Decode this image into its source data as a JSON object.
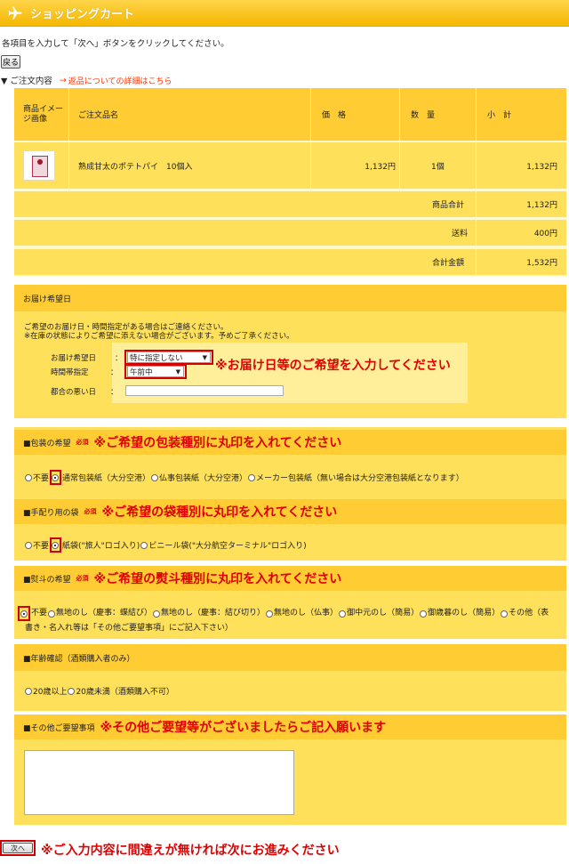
{
  "header": {
    "title": "ショッピングカート"
  },
  "instructions": "各項目を入力して「次へ」ボタンをクリックしてください。",
  "back_label": "戻る",
  "order": {
    "heading": "▼ ご注文内容",
    "return_arrow": "→",
    "return_link": "返品についての詳細はこちら",
    "columns": [
      "商品イメージ画像",
      "ご注文品名",
      "価　格",
      "数　量",
      "小　計"
    ],
    "product": {
      "name": "熟成甘太のポテトパイ　10個入",
      "price": "1,132円",
      "qty": "1個",
      "subtotal": "1,132円"
    },
    "totals": [
      {
        "label": "商品合計",
        "value": "1,132円"
      },
      {
        "label": "送料",
        "value": "400円"
      },
      {
        "label": "合計金額",
        "value": "1,532円"
      }
    ]
  },
  "delivery": {
    "title": "お届け希望日",
    "note1": "ご希望のお届け日・時間指定がある場合はご連絡ください。",
    "note2": "※在庫の状態によりご希望に添えない場合がございます。予めご了承ください。",
    "date_label": "お届け希望日",
    "date_value": "特に指定しない",
    "time_label": "時間帯指定",
    "time_value": "午前中",
    "bad_day_label": "都合の悪い日",
    "colon": "：",
    "annotation": "※お届け日等のご希望を入力してください"
  },
  "wrapping": {
    "title": "■包装の希望",
    "required": "必須",
    "annotation": "※ご希望の包装種別に丸印を入れてください",
    "options": [
      "不要",
      "通常包装紙（大分空港）",
      "仏事包装紙（大分空港）",
      "メーカー包装紙（無い場合は大分空港包装紙となります）"
    ]
  },
  "bag": {
    "title": "■手配り用の袋",
    "required": "必須",
    "annotation": "※ご希望の袋種別に丸印を入れてください",
    "options": [
      "不要",
      "紙袋(\"旅人\"ロゴ入り)",
      "ビニール袋(\"大分航空ターミナル\"ロゴ入り)"
    ]
  },
  "noshi": {
    "title": "■熨斗の希望",
    "required": "必須",
    "annotation": "※ご希望の熨斗種別に丸印を入れてください",
    "options": [
      "不要",
      "無地のし（慶事：蝶結び）",
      "無地のし（慶事：結び切り）",
      "無地のし（仏事）",
      "御中元のし（簡易）",
      "御歳暮のし（簡易）",
      "その他（表"
    ],
    "line2": "書き・名入れ等は「その他ご要望事項」にご記入下さい）"
  },
  "age": {
    "title": "■年齢確認（酒類購入者のみ）",
    "options": [
      "20歳以上",
      "20歳未満（酒類購入不可）"
    ]
  },
  "other": {
    "title": "■その他ご要望事項",
    "annotation": "※その他ご要望等がございましたらご記入願います"
  },
  "next": {
    "label": "次へ",
    "annotation": "※ご入力内容に間違えが無ければ次にお進みください"
  },
  "colors": {
    "header": "#f5b800",
    "panel": "#ffe05a",
    "panel_head": "#ffcc33",
    "annotation": "#e00000",
    "link": "#ff3300"
  }
}
